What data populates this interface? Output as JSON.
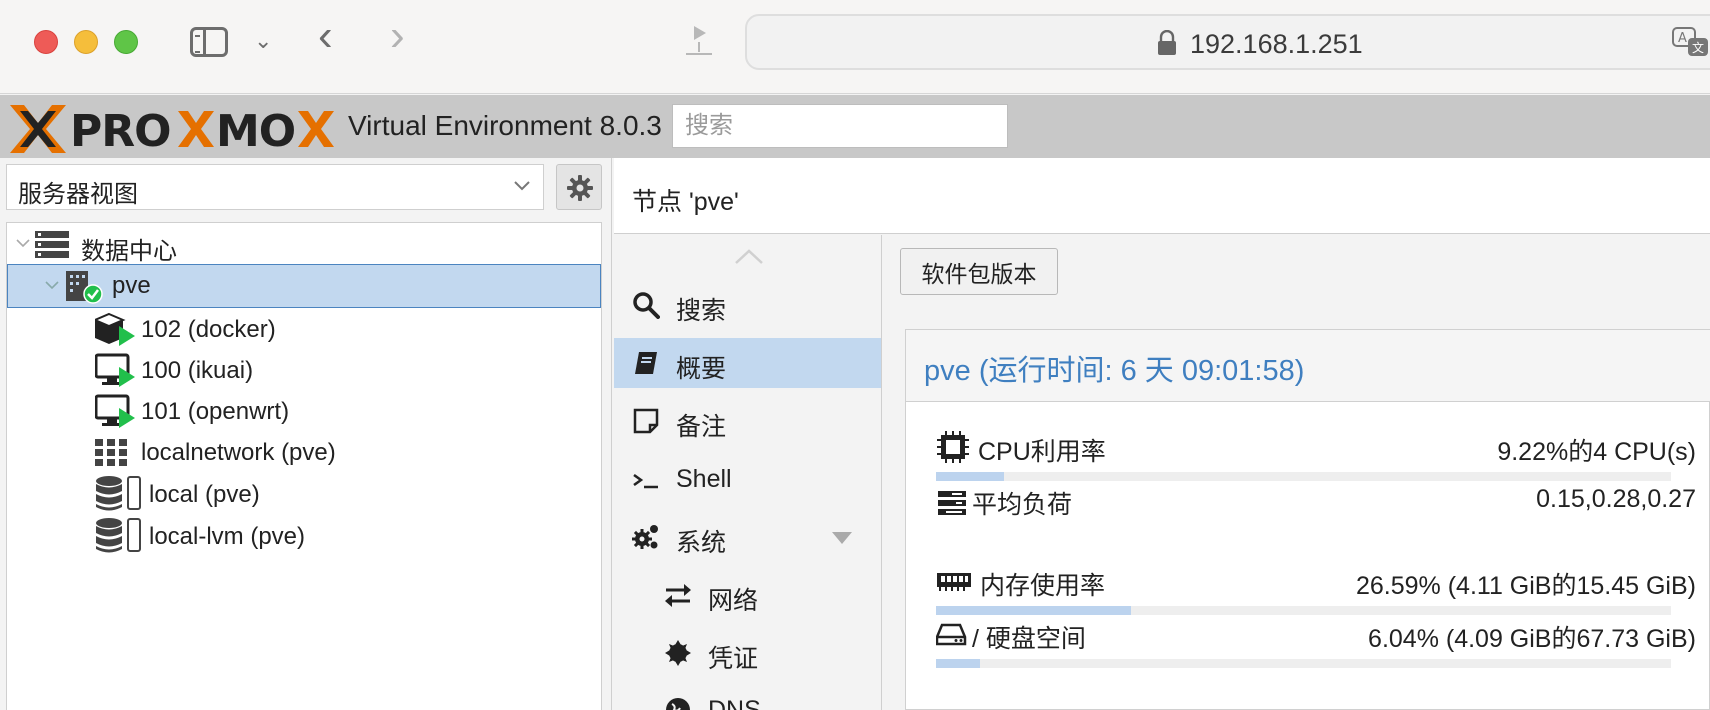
{
  "browser": {
    "address": "192.168.1.251"
  },
  "header": {
    "logo_text": "PROXMOX",
    "version": "Virtual Environment 8.0.3",
    "search_placeholder": "搜索"
  },
  "left": {
    "view_label": "服务器视图",
    "tree": [
      {
        "label": "数据中心",
        "icon": "datacenter-icon"
      },
      {
        "label": "pve",
        "icon": "node-online-icon"
      },
      {
        "label": "102 (docker)",
        "icon": "container-running-icon"
      },
      {
        "label": "100 (ikuai)",
        "icon": "vm-running-icon"
      },
      {
        "label": "101 (openwrt)",
        "icon": "vm-running-icon"
      },
      {
        "label": "localnetwork (pve)",
        "icon": "network-grid-icon"
      },
      {
        "label": "local (pve)",
        "icon": "storage-icon"
      },
      {
        "label": "local-lvm (pve)",
        "icon": "storage-icon"
      }
    ]
  },
  "node": {
    "title": "节点 'pve'"
  },
  "menu": {
    "items": [
      {
        "label": "搜索",
        "icon": "search-icon"
      },
      {
        "label": "概要",
        "icon": "book-icon"
      },
      {
        "label": "备注",
        "icon": "note-icon"
      },
      {
        "label": "Shell",
        "icon": "terminal-icon"
      },
      {
        "label": "系统",
        "icon": "cogs-icon"
      },
      {
        "label": "网络",
        "icon": "exchange-icon"
      },
      {
        "label": "凭证",
        "icon": "certificate-icon"
      },
      {
        "label": "DNS",
        "icon": "globe-icon"
      }
    ]
  },
  "content": {
    "package_button": "软件包版本",
    "status_title": "pve (运行时间: 6 天 09:01:58)",
    "stats": [
      {
        "label": "CPU利用率",
        "value": "9.22%的4 CPU(s)",
        "percent": 9.22,
        "icon": "cpu-icon"
      },
      {
        "label": "平均负荷",
        "value": "0.15,0.28,0.27",
        "icon": "tasks-icon"
      },
      {
        "label": "内存使用率",
        "value": "26.59% (4.11 GiB的15.45 GiB)",
        "percent": 26.59,
        "icon": "memory-icon"
      },
      {
        "label": "/ 硬盘空间",
        "value": "6.04% (4.09 GiB的67.73 GiB)",
        "percent": 6.04,
        "icon": "hdd-icon"
      }
    ]
  },
  "colors": {
    "accent": "#3f7fc0",
    "selection": "#c2d8ef",
    "logo_orange": "#e57000",
    "running_green": "#21bf4b"
  }
}
